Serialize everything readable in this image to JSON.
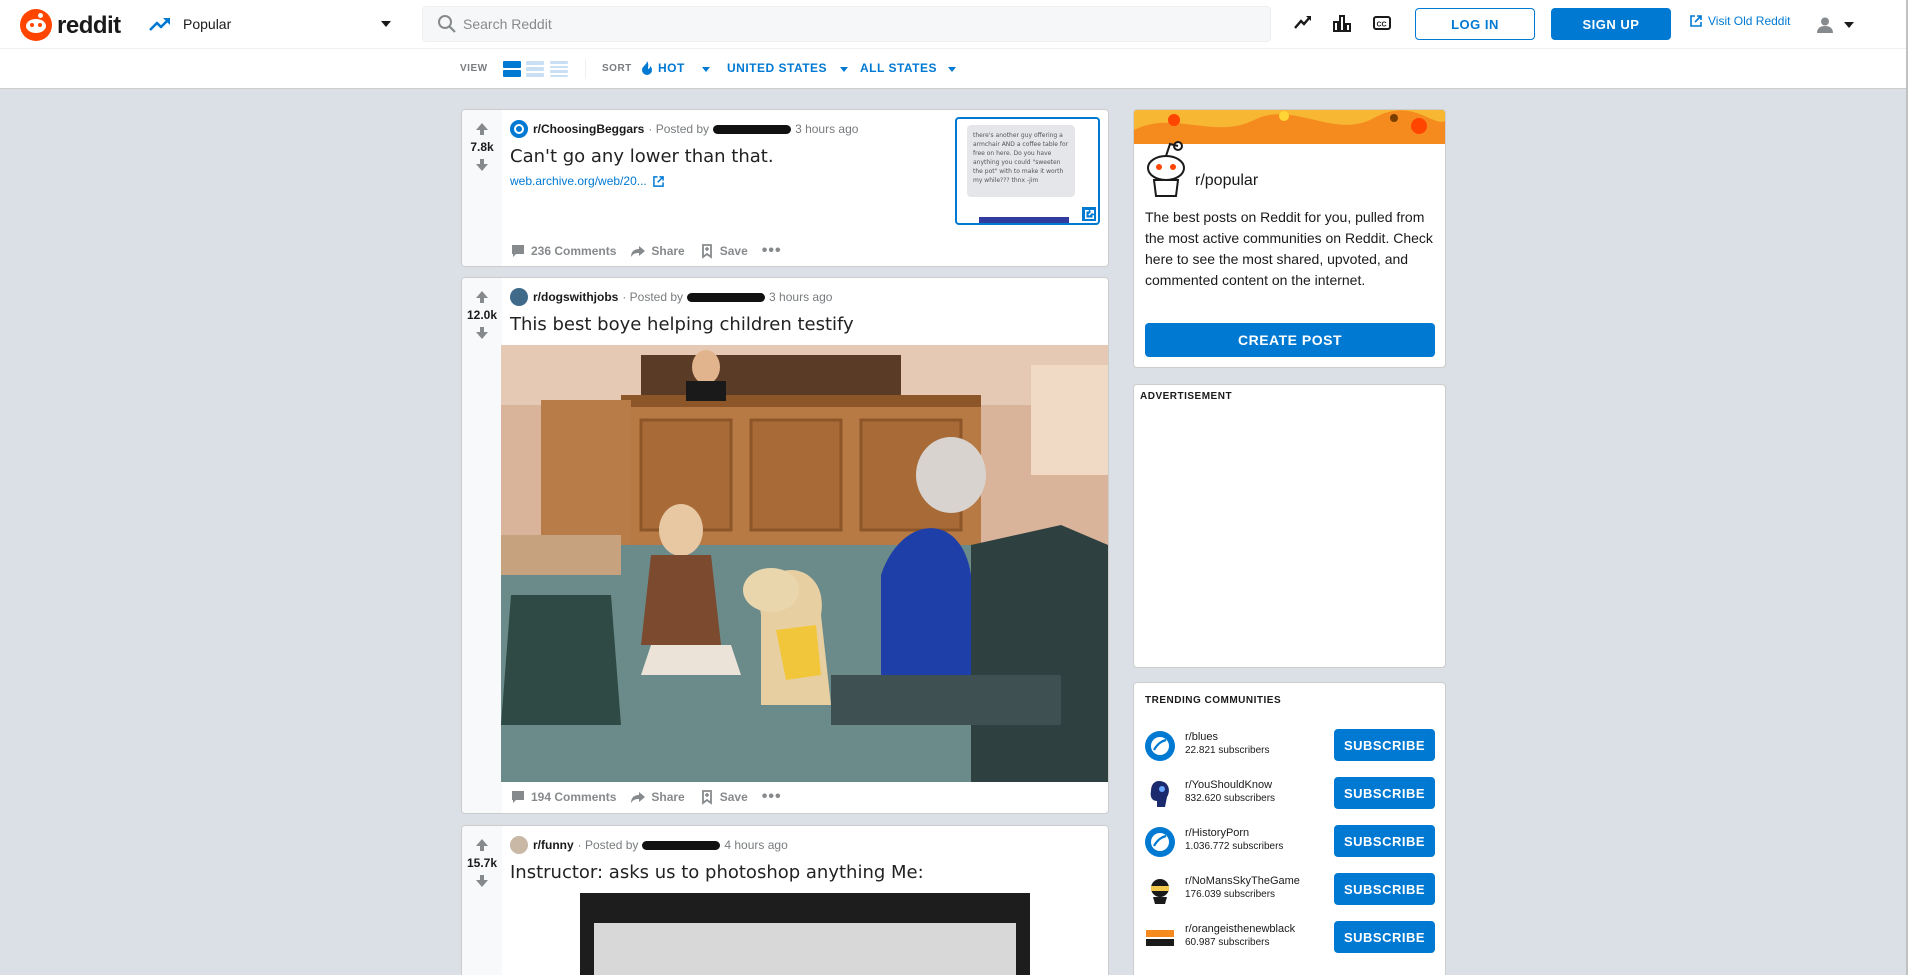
{
  "header": {
    "wordmark": "reddit",
    "feed_label": "Popular",
    "search_placeholder": "Search Reddit",
    "login_label": "LOG IN",
    "signup_label": "SIGN UP",
    "old_reddit_label": "Visit Old Reddit"
  },
  "subbar": {
    "view_caption": "VIEW",
    "sort_caption": "SORT",
    "sort_hot": "HOT",
    "region": "UNITED STATES",
    "states": "ALL STATES"
  },
  "posts": [
    {
      "subreddit": "r/ChoosingBeggars",
      "posted_by": "· Posted by",
      "time": "3 hours ago",
      "score": "7.8k",
      "title": "Can't go any lower than that.",
      "link": "web.archive.org/web/20...",
      "thumb_text": "there's another guy offering a armchair AND a coffee table for free on here. Do you have anything you could \"sweeten the pot\" with to make it worth my while??? thnx -jim",
      "comments": "236 Comments",
      "share": "Share",
      "save": "Save"
    },
    {
      "subreddit": "r/dogswithjobs",
      "posted_by": "· Posted by",
      "time": "3 hours ago",
      "score": "12.0k",
      "title": "This best boye helping children testify",
      "comments": "194 Comments",
      "share": "Share",
      "save": "Save"
    },
    {
      "subreddit": "r/funny",
      "posted_by": "· Posted by",
      "time": "4 hours ago",
      "score": "15.7k",
      "title": "Instructor: asks us to photoshop anything Me:"
    }
  ],
  "sidebar": {
    "popular_title": "r/popular",
    "popular_desc": "The best posts on Reddit for you, pulled from the most active communities on Reddit. Check here to see the most shared, upvoted, and commented content on the internet.",
    "create_post": "CREATE POST",
    "ad_label": "ADVERTISEMENT",
    "trending_title": "TRENDING COMMUNITIES",
    "subscribe_label": "SUBSCRIBE",
    "communities": [
      {
        "name": "r/blues",
        "subs": "22.821 subscribers"
      },
      {
        "name": "r/YouShouldKnow",
        "subs": "832.620 subscribers"
      },
      {
        "name": "r/HistoryPorn",
        "subs": "1.036.772 subscribers"
      },
      {
        "name": "r/NoMansSkyTheGame",
        "subs": "176.039 subscribers"
      },
      {
        "name": "r/orangeisthenewblack",
        "subs": "60.987 subscribers"
      }
    ]
  },
  "colors": {
    "brand": "#ff4500",
    "accent": "#0079d3",
    "background": "#dae0e6"
  }
}
